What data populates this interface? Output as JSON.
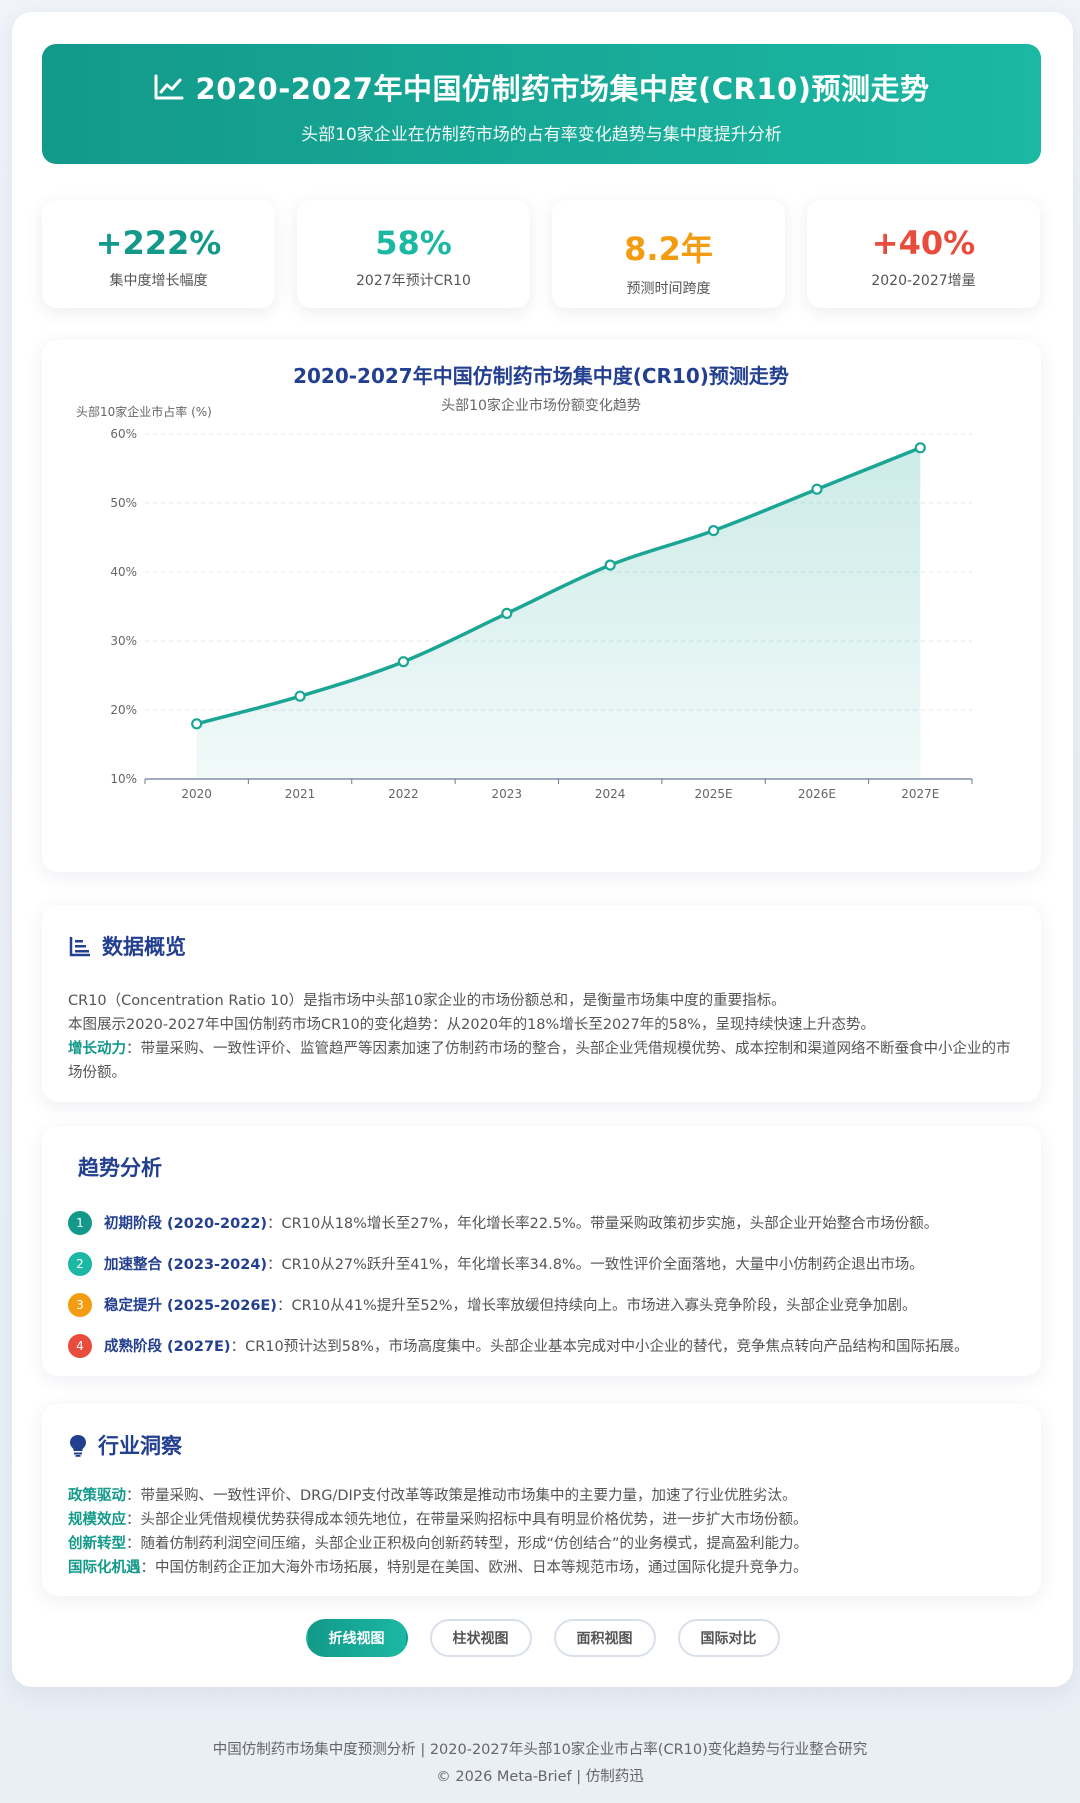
{
  "header": {
    "icon": "line-chart-icon",
    "title": "2020-2027年中国仿制药市场集中度(CR10)预测走势",
    "subtitle": "头部10家企业在仿制药市场的占有率变化趋势与集中度提升分析"
  },
  "stats": [
    {
      "value": "+222%",
      "label": "集中度增长幅度",
      "color": "#13998a"
    },
    {
      "value": "58%",
      "label": "2027年预计CR10",
      "color": "#1bb8a3"
    },
    {
      "value": "8.2年",
      "label": "预测时间跨度",
      "color": "#f39c12"
    },
    {
      "value": "+40%",
      "label": "2020-2027增量",
      "color": "#e74c3c"
    }
  ],
  "chart_data": {
    "type": "area",
    "title": "2020-2027年中国仿制药市场集中度(CR10)预测走势",
    "subtitle": "头部10家企业市场份额变化趋势",
    "ylabel": "头部10家企业市占率 (%)",
    "xlabel": "",
    "categories": [
      "2020",
      "2021",
      "2022",
      "2023",
      "2024",
      "2025E",
      "2026E",
      "2027E"
    ],
    "values": [
      18,
      22,
      27,
      34,
      41,
      46,
      52,
      58
    ],
    "ylim": [
      10,
      60
    ],
    "yticks": [
      "10%",
      "20%",
      "30%",
      "40%",
      "50%",
      "60%"
    ],
    "grid": true,
    "line_color": "#1aa595",
    "title_color": "#233f8f"
  },
  "overview": {
    "icon": "bar-list-icon",
    "title": "数据概览",
    "line1": "CR10（Concentration Ratio 10）是指市场中头部10家企业的市场份额总和，是衡量市场集中度的重要指标。",
    "line2": "本图展示2020-2027年中国仿制药市场CR10的变化趋势：从2020年的18%增长至2027年的58%，呈现持续快速上升态势。",
    "line3_label": "增长动力",
    "line3_text": "：带量采购、一致性评价、监管趋严等因素加速了仿制药市场的整合，头部企业凭借规模优势、成本控制和渠道网络不断蚕食中小企业的市场份额。"
  },
  "trend": {
    "title": "趋势分析",
    "items": [
      {
        "num": "1",
        "color": "#13998a",
        "stage": "初期阶段 (2020-2022)",
        "text": "：CR10从18%增长至27%，年化增长率22.5%。带量采购政策初步实施，头部企业开始整合市场份额。"
      },
      {
        "num": "2",
        "color": "#1bb8a3",
        "stage": "加速整合 (2023-2024)",
        "text": "：CR10从27%跃升至41%，年化增长率34.8%。一致性评价全面落地，大量中小仿制药企退出市场。"
      },
      {
        "num": "3",
        "color": "#f39c12",
        "stage": "稳定提升 (2025-2026E)",
        "text": "：CR10从41%提升至52%，增长率放缓但持续向上。市场进入寡头竞争阶段，头部企业竞争加剧。"
      },
      {
        "num": "4",
        "color": "#e74c3c",
        "stage": "成熟阶段 (2027E)",
        "text": "：CR10预计达到58%，市场高度集中。头部企业基本完成对中小企业的替代，竞争焦点转向产品结构和国际拓展。"
      }
    ]
  },
  "insight": {
    "icon": "lightbulb-icon",
    "title": "行业洞察",
    "items": [
      {
        "label": "政策驱动",
        "text": "：带量采购、一致性评价、DRG/DIP支付改革等政策是推动市场集中的主要力量，加速了行业优胜劣汰。"
      },
      {
        "label": "规模效应",
        "text": "：头部企业凭借规模优势获得成本领先地位，在带量采购招标中具有明显价格优势，进一步扩大市场份额。"
      },
      {
        "label": "创新转型",
        "text": "：随着仿制药利润空间压缩，头部企业正积极向创新药转型，形成“仿创结合”的业务模式，提高盈利能力。"
      },
      {
        "label": "国际化机遇",
        "text": "：中国仿制药企正加大海外市场拓展，特别是在美国、欧洲、日本等规范市场，通过国际化提升竞争力。"
      }
    ]
  },
  "buttons": [
    "折线视图",
    "柱状视图",
    "面积视图",
    "国际对比"
  ],
  "footer": {
    "line1": "中国仿制药市场集中度预测分析 | 2020-2027年头部10家企业市占率(CR10)变化趋势与行业整合研究",
    "line2": "© 2026 Meta-Brief | 仿制药迅"
  }
}
